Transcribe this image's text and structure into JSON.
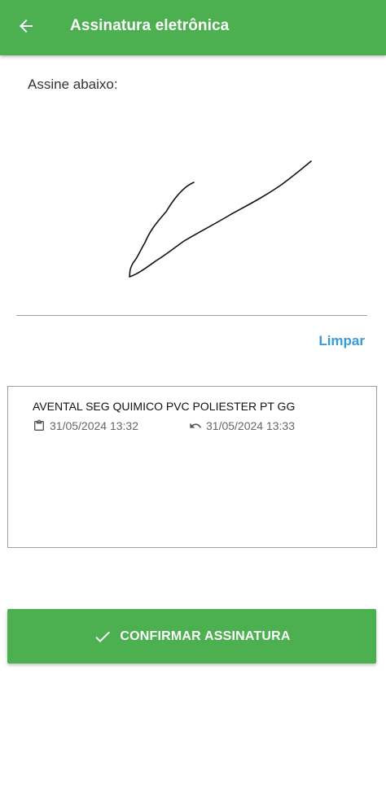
{
  "header": {
    "title": "Assinatura eletrônica",
    "back_icon": "arrow-left-icon",
    "background_color": "#4caf50"
  },
  "signature": {
    "label": "Assine abaixo:",
    "clear_label": "Limpar"
  },
  "items": [
    {
      "name": "AVENTAL SEG QUIMICO PVC POLIESTER PT GG",
      "delivered_icon": "clipboard-icon",
      "delivered_at": "31/05/2024 13:32",
      "return_icon": "undo-icon",
      "return_at": "31/05/2024 13:33"
    }
  ],
  "confirm": {
    "icon": "check-icon",
    "label": "CONFIRMAR ASSINATURA"
  },
  "colors": {
    "primary": "#4caf50",
    "link": "#3a9bd9"
  }
}
